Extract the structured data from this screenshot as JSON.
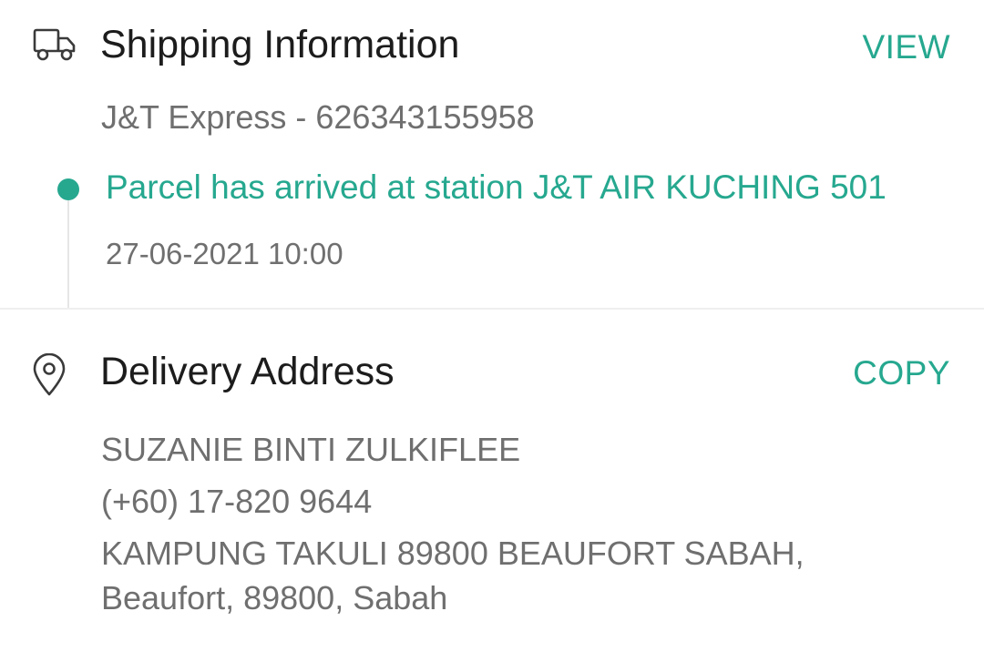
{
  "shipping": {
    "title": "Shipping Information",
    "action_label": "VIEW",
    "courier": "J&T Express - 626343155958",
    "latest_status": "Parcel has arrived at station J&T AIR KUCHING 501",
    "latest_time": "27-06-2021 10:00",
    "icon": "truck-icon"
  },
  "address": {
    "title": "Delivery Address",
    "action_label": "COPY",
    "name": "SUZANIE BINTI ZULKIFLEE",
    "phone": "(+60) 17-820 9644",
    "street": "KAMPUNG TAKULI 89800 BEAUFORT SABAH,",
    "city": "Beaufort, 89800, Sabah",
    "icon": "location-pin-icon"
  },
  "colors": {
    "accent": "#26a88f",
    "text_primary": "#1c1c1c",
    "text_secondary": "#6f6f6f",
    "divider": "#efefef"
  }
}
